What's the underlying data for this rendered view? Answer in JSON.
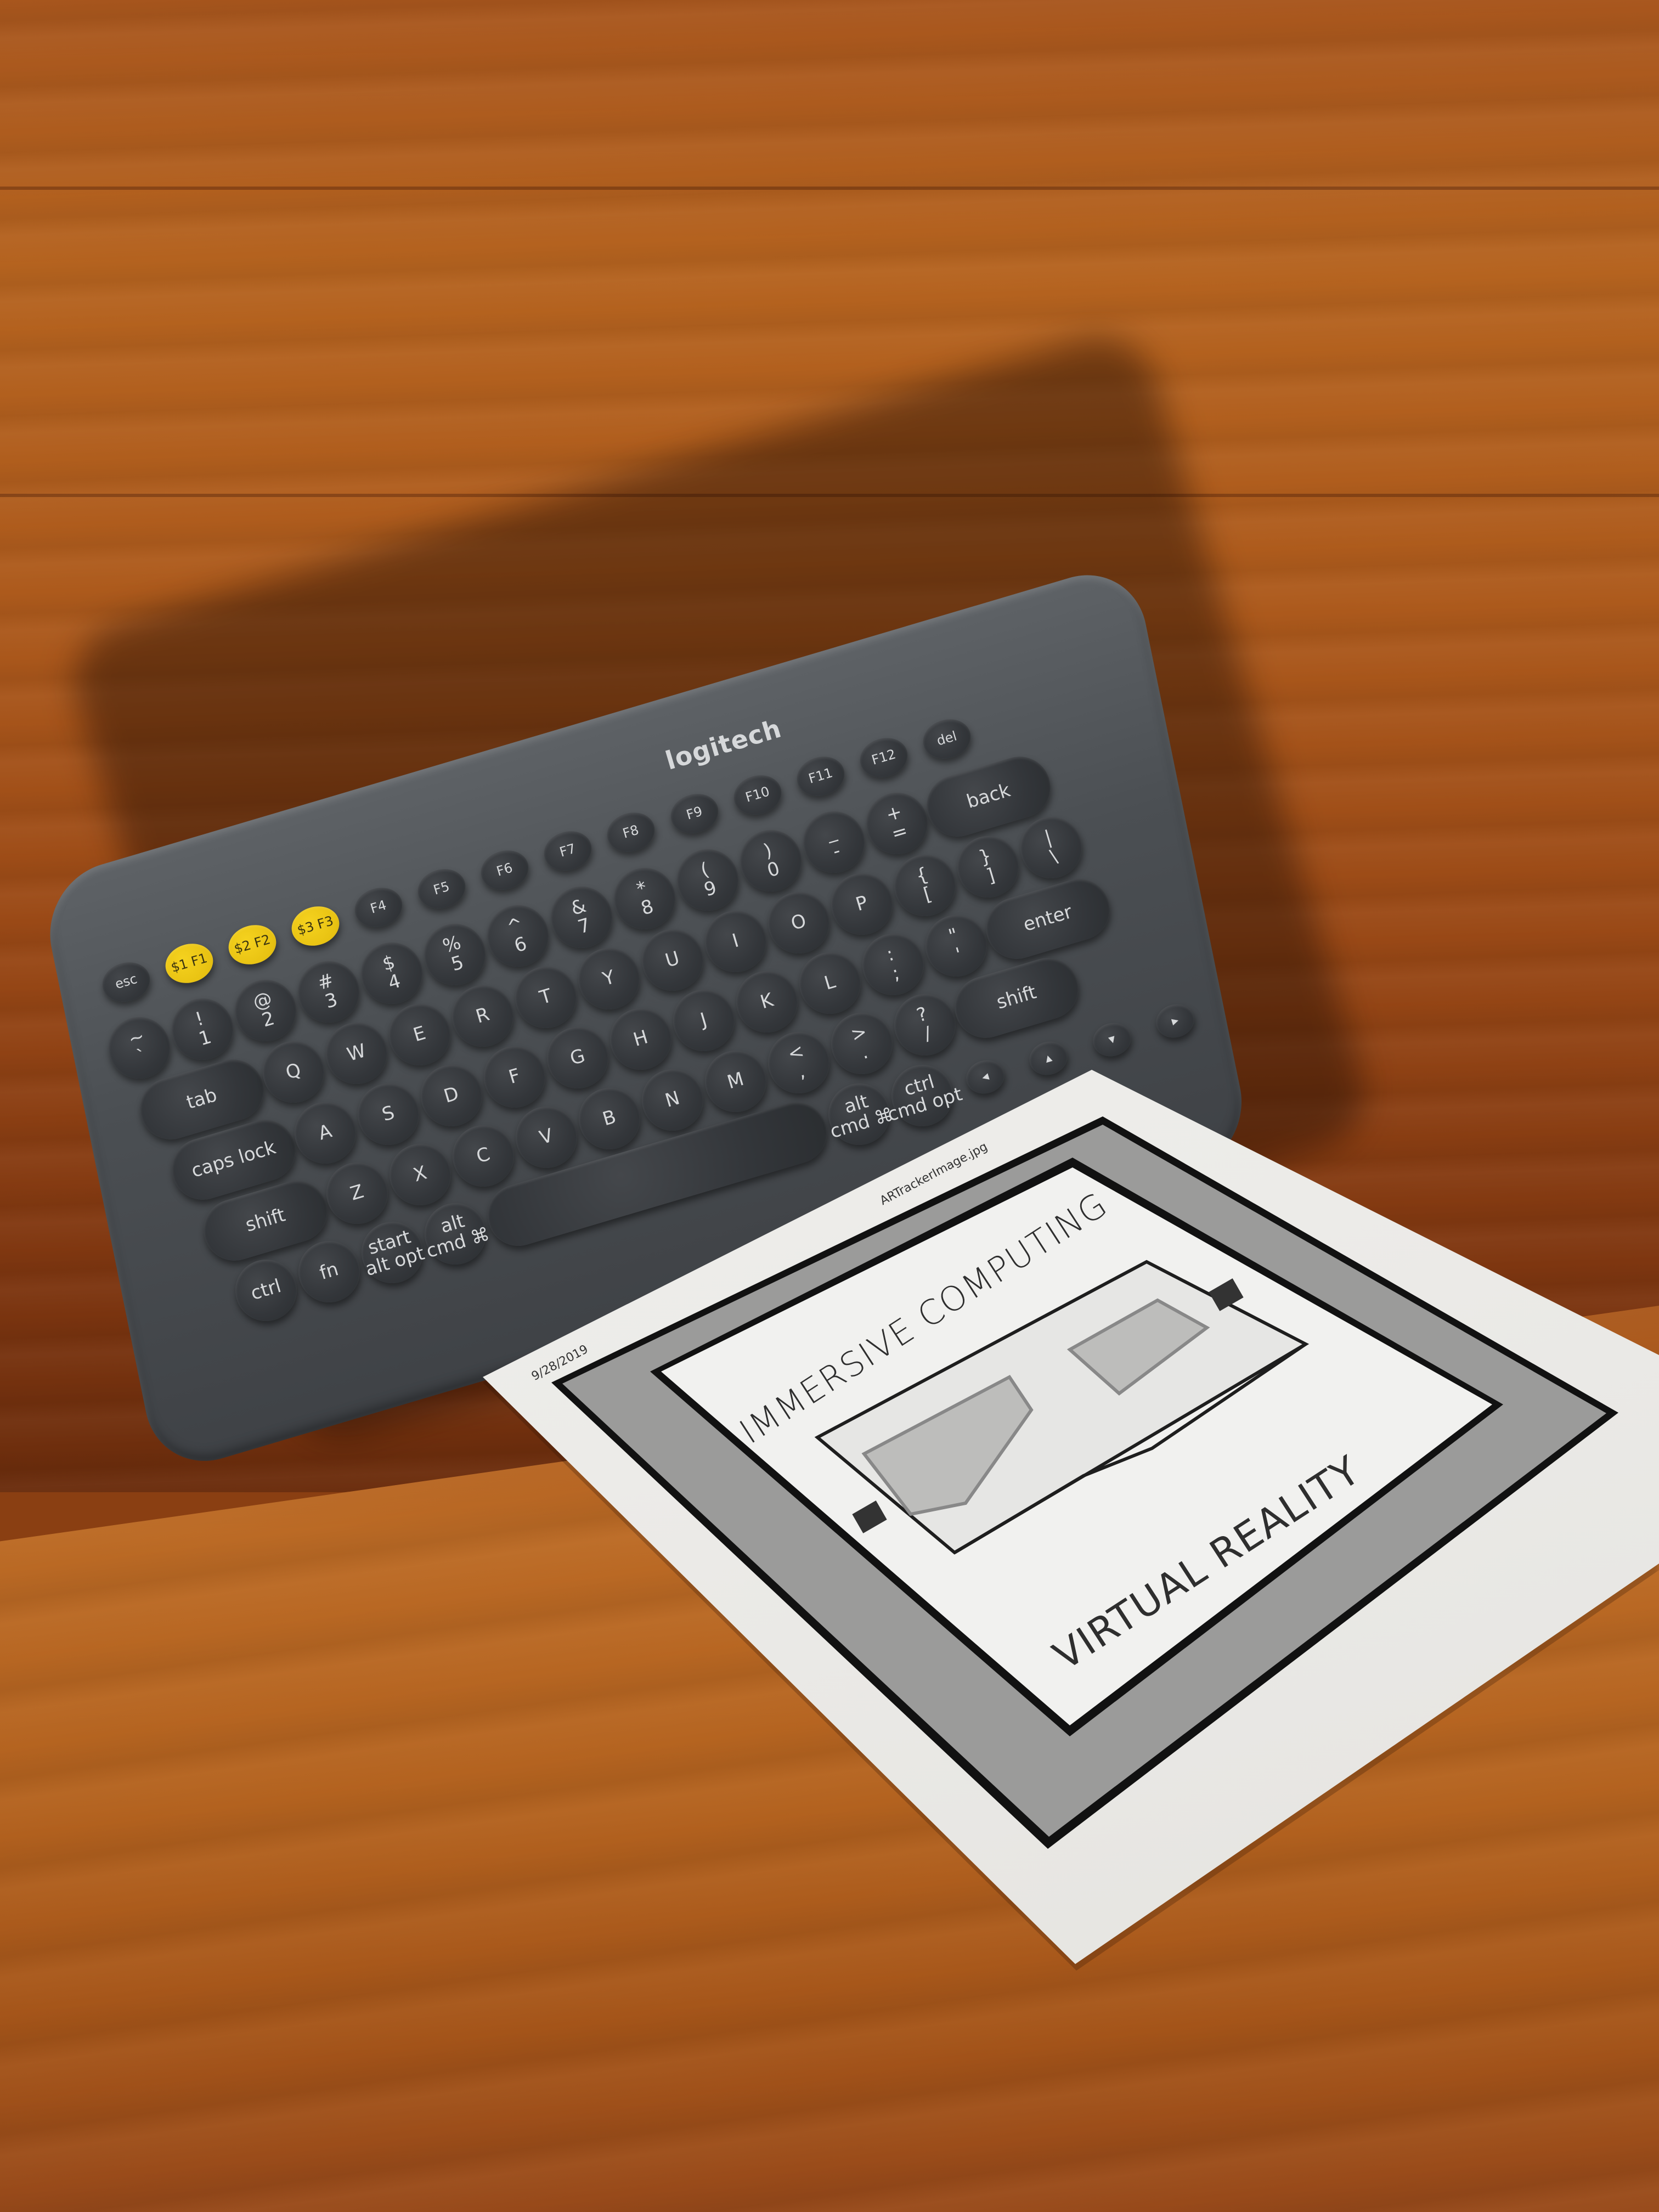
{
  "scene": "logitech keyboard leaning against wooden cabinet wall, printed AR marker sheet on shelf",
  "keyboard": {
    "brand": "logitech",
    "rows": [
      [
        "esc",
        "$1 F1",
        "$2 F2",
        "$3 F3",
        "F4",
        "F5",
        "F6",
        "F7",
        "F8",
        "F9",
        "F10",
        "F11",
        "F12",
        "del"
      ],
      [
        "~\n`",
        "!\n1",
        "@\n2",
        "#\n3",
        "$\n4",
        "%\n5",
        "^\n6",
        "&\n7",
        "*\n8",
        "(\n9",
        ")\n0",
        "_\n-",
        "+\n=",
        "back"
      ],
      [
        "tab",
        "Q",
        "W",
        "E",
        "R",
        "T",
        "Y",
        "U",
        "I",
        "O",
        "P",
        "{\n[",
        "}\n]",
        "|\n\\"
      ],
      [
        "caps lock",
        "A",
        "S",
        "D",
        "F",
        "G",
        "H",
        "J",
        "K",
        "L",
        ":\n;",
        "\"\n'",
        "enter"
      ],
      [
        "shift",
        "Z",
        "X",
        "C",
        "V",
        "B",
        "N",
        "M",
        "<\n,",
        ">\n.",
        "?\n/",
        "shift"
      ],
      [
        "ctrl",
        "fn",
        "start\nalt opt",
        "alt\ncmd ⌘",
        "",
        "alt\ncmd ⌘",
        "ctrl\ncmd opt",
        "◂",
        "▴",
        "▾",
        "▸"
      ]
    ]
  },
  "sheet": {
    "date": "9/28/2019",
    "filename": "ARTrackerImage.jpg",
    "top_text": "IMMERSIVE COMPUTING",
    "bottom_text": "VIRTUAL REALITY",
    "colors": {
      "border": "#111111",
      "gray_band": "#9b9b9a",
      "paper": "#f1f1ef"
    }
  }
}
